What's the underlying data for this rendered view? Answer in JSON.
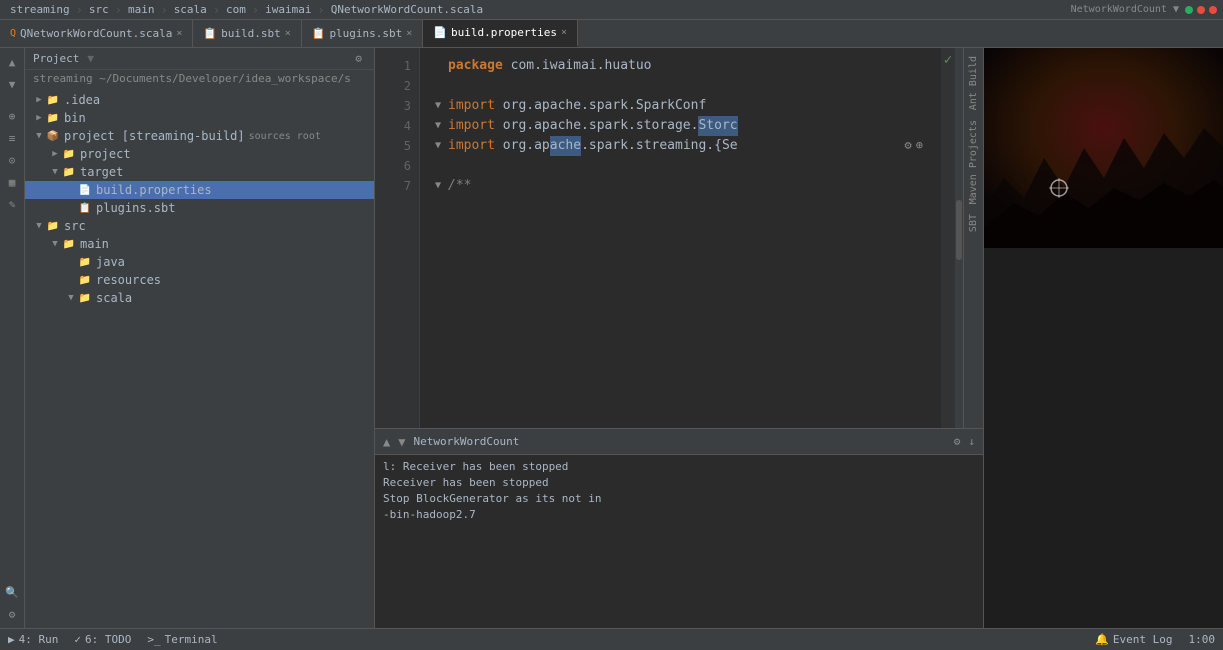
{
  "topbar": {
    "items": [
      "streaming",
      "src",
      "main",
      "scala",
      "com",
      "iwaimai",
      "QNetworkWordCount.scala"
    ]
  },
  "tabs": [
    {
      "id": "qnetwork",
      "label": "QNetworkWordCount.scala",
      "icon": "📄",
      "active": false
    },
    {
      "id": "buildsbt",
      "label": "build.sbt",
      "icon": "📄",
      "active": false
    },
    {
      "id": "plugins",
      "label": "plugins.sbt",
      "icon": "📄",
      "active": false
    },
    {
      "id": "buildprops",
      "label": "build.properties",
      "icon": "📄",
      "active": true
    }
  ],
  "sidebar": {
    "header": "Project",
    "path": "streaming ~/Documents/Developer/idea_workspace/s",
    "tree": [
      {
        "id": "idea",
        "label": ".idea",
        "level": 1,
        "type": "folder",
        "expanded": false
      },
      {
        "id": "bin",
        "label": "bin",
        "level": 1,
        "type": "folder",
        "expanded": false
      },
      {
        "id": "project",
        "label": "project [streaming-build]",
        "level": 1,
        "type": "project",
        "expanded": true,
        "extra": "sources root"
      },
      {
        "id": "project-sub",
        "label": "project",
        "level": 2,
        "type": "folder",
        "expanded": false
      },
      {
        "id": "target",
        "label": "target",
        "level": 2,
        "type": "folder",
        "expanded": true
      },
      {
        "id": "build-props",
        "label": "build.properties",
        "level": 3,
        "type": "properties",
        "selected": true
      },
      {
        "id": "plugins-sbt",
        "label": "plugins.sbt",
        "level": 3,
        "type": "sbt"
      },
      {
        "id": "src",
        "label": "src",
        "level": 1,
        "type": "folder",
        "expanded": true
      },
      {
        "id": "main",
        "label": "main",
        "level": 2,
        "type": "folder",
        "expanded": true
      },
      {
        "id": "java",
        "label": "java",
        "level": 3,
        "type": "folder",
        "expanded": false
      },
      {
        "id": "resources",
        "label": "resources",
        "level": 3,
        "type": "folder",
        "expanded": false
      },
      {
        "id": "scala",
        "label": "scala",
        "level": 3,
        "type": "folder",
        "expanded": true
      }
    ]
  },
  "editor": {
    "filename": "QNetworkWordCount.scala",
    "breadcrumb": "",
    "lines": [
      {
        "num": 1,
        "content": "package com.iwaimai.huatuo",
        "type": "package"
      },
      {
        "num": 2,
        "content": "",
        "type": "blank"
      },
      {
        "num": 3,
        "content": "import org.apache.spark.SparkConf",
        "type": "import"
      },
      {
        "num": 4,
        "content": "import org.apache.spark.storage.Storc",
        "type": "import"
      },
      {
        "num": 5,
        "content": "import org.apache.spark.streaming.{Se",
        "type": "import"
      },
      {
        "num": 6,
        "content": "",
        "type": "blank"
      },
      {
        "num": 7,
        "content": "/**",
        "type": "comment"
      }
    ]
  },
  "rightPanel": {
    "tabs": [
      "Ant Build",
      "Maven Projects",
      "SBT"
    ]
  },
  "console": {
    "toolbar": "NetworkWordCount",
    "lines": [
      "l: Receiver has been stopped",
      "",
      "Receiver has been stopped",
      "Stop BlockGenerator as its not in",
      "",
      "-bin-hadoop2.7"
    ]
  },
  "statusBar": {
    "run": "4: Run",
    "todo": "6: TODO",
    "terminal": "Terminal",
    "eventLog": "Event Log",
    "time": "1:00"
  }
}
